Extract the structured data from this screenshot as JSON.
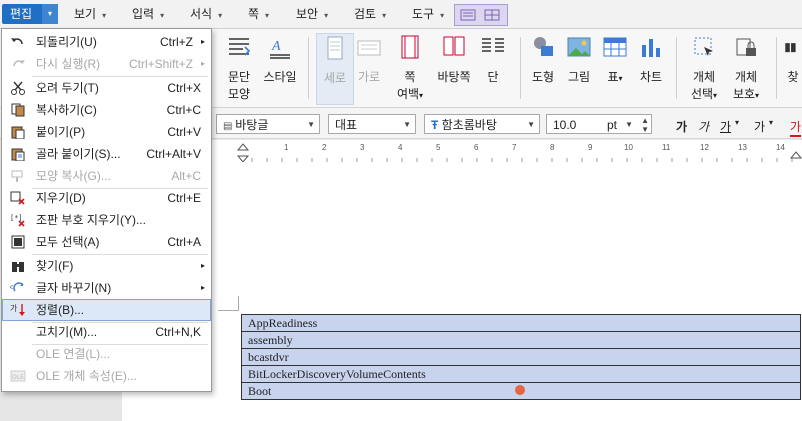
{
  "menubar": {
    "items": [
      {
        "label": "편집"
      },
      {
        "label": "보기"
      },
      {
        "label": "입력"
      },
      {
        "label": "서식"
      },
      {
        "label": "쪽"
      },
      {
        "label": "보안"
      },
      {
        "label": "검토"
      },
      {
        "label": "도구"
      }
    ]
  },
  "ribbon": {
    "buttons": [
      {
        "label": "문단",
        "label2": "모양"
      },
      {
        "label": "스타일"
      },
      {
        "label": "세로"
      },
      {
        "label": "가로"
      },
      {
        "label": "쪽",
        "label2": "여백"
      },
      {
        "label": "바탕쪽"
      },
      {
        "label": "단"
      },
      {
        "label": "도형"
      },
      {
        "label": "그림"
      },
      {
        "label": "표"
      },
      {
        "label": "차트"
      },
      {
        "label": "개체",
        "label2": "선택"
      },
      {
        "label": "개체",
        "label2": "보호"
      },
      {
        "label": "찾"
      }
    ]
  },
  "format": {
    "style": "바탕글",
    "lang": "대표",
    "font": "함초롬바탕",
    "size": "10.0",
    "unit": "pt",
    "bold": "가",
    "italic": "가",
    "underline": "가",
    "strike": "가",
    "color": "가"
  },
  "ruler": {
    "numbers": [
      "1",
      "2",
      "3",
      "4",
      "5",
      "6",
      "7",
      "8",
      "9",
      "10",
      "11",
      "12",
      "13",
      "14"
    ]
  },
  "table": {
    "rows": [
      "AppReadiness",
      "assembly",
      "bcastdvr",
      "BitLockerDiscoveryVolumeContents",
      "Boot"
    ]
  },
  "edit_menu": {
    "items": [
      {
        "label": "되돌리기(U)",
        "shortcut": "Ctrl+Z",
        "arrow": "▸",
        "disabled": false
      },
      {
        "label": "다시 실행(R)",
        "shortcut": "Ctrl+Shift+Z",
        "arrow": "▸",
        "disabled": true
      },
      {
        "label": "오려 두기(T)",
        "shortcut": "Ctrl+X",
        "disabled": false
      },
      {
        "label": "복사하기(C)",
        "shortcut": "Ctrl+C",
        "disabled": false
      },
      {
        "label": "붙이기(P)",
        "shortcut": "Ctrl+V",
        "disabled": false
      },
      {
        "label": "골라 붙이기(S)...",
        "shortcut": "Ctrl+Alt+V",
        "disabled": false
      },
      {
        "label": "모양 복사(G)...",
        "shortcut": "Alt+C",
        "disabled": true
      },
      {
        "label": "지우기(D)",
        "shortcut": "Ctrl+E",
        "disabled": false
      },
      {
        "label": "조판 부호 지우기(Y)...",
        "shortcut": "",
        "disabled": false
      },
      {
        "label": "모두 선택(A)",
        "shortcut": "Ctrl+A",
        "disabled": false
      },
      {
        "label": "찾기(F)",
        "shortcut": "",
        "arrow": "▸",
        "disabled": false
      },
      {
        "label": "글자 바꾸기(N)",
        "shortcut": "",
        "arrow": "▸",
        "disabled": false
      },
      {
        "label": "정렬(B)...",
        "shortcut": "",
        "disabled": false,
        "highlighted": true
      },
      {
        "label": "고치기(M)...",
        "shortcut": "Ctrl+N,K",
        "disabled": false
      },
      {
        "label": "OLE 연결(L)...",
        "shortcut": "",
        "disabled": true
      },
      {
        "label": "OLE 개체 속성(E)...",
        "shortcut": "",
        "disabled": true
      }
    ]
  },
  "colors": {
    "accent": "#1f6fc5",
    "table_fill": "#c8d3ee",
    "highlight": "#dce8f7",
    "cursor": "#e8643c"
  }
}
